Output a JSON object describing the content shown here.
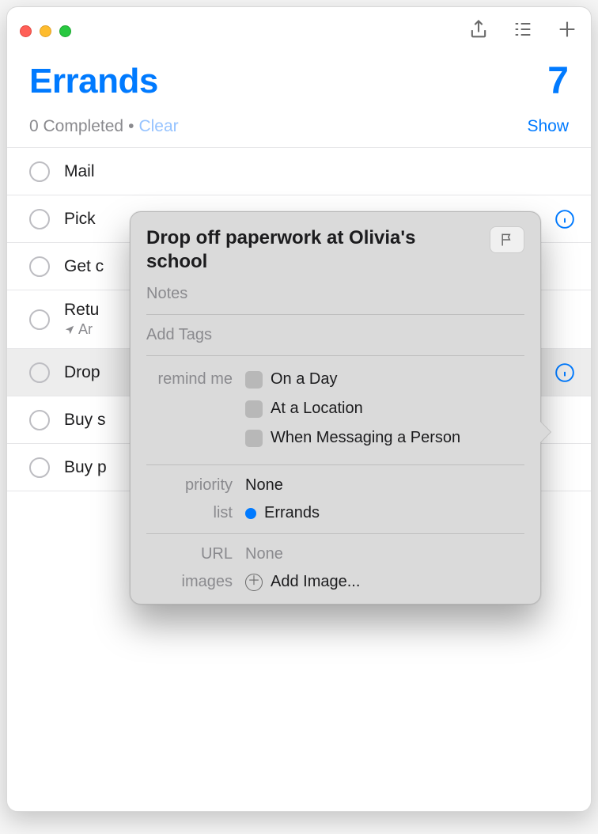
{
  "header": {
    "list_title": "Errands",
    "count": "7",
    "completed_text": "0 Completed",
    "clear_label": "Clear",
    "show_label": "Show"
  },
  "items": [
    {
      "title": "Mail ",
      "has_info": false
    },
    {
      "title": "Pick ",
      "has_info": true
    },
    {
      "title": "Get c",
      "has_info": false
    },
    {
      "title": "Retu",
      "sub_prefix": "Ar",
      "has_info": false
    },
    {
      "title": "Drop",
      "has_info": true,
      "selected": true
    },
    {
      "title": "Buy s",
      "has_info": false
    },
    {
      "title": "Buy p",
      "has_info": false
    }
  ],
  "popover": {
    "title": "Drop off paperwork at Olivia's school",
    "notes_placeholder": "Notes",
    "tags_placeholder": "Add Tags",
    "remind_label": "remind me",
    "remind_options": {
      "day": "On a Day",
      "location": "At a Location",
      "messaging": "When Messaging a Person"
    },
    "priority_label": "priority",
    "priority_value": "None",
    "list_label": "list",
    "list_value": "Errands",
    "url_label": "URL",
    "url_value": "None",
    "images_label": "images",
    "images_action": "Add Image..."
  }
}
